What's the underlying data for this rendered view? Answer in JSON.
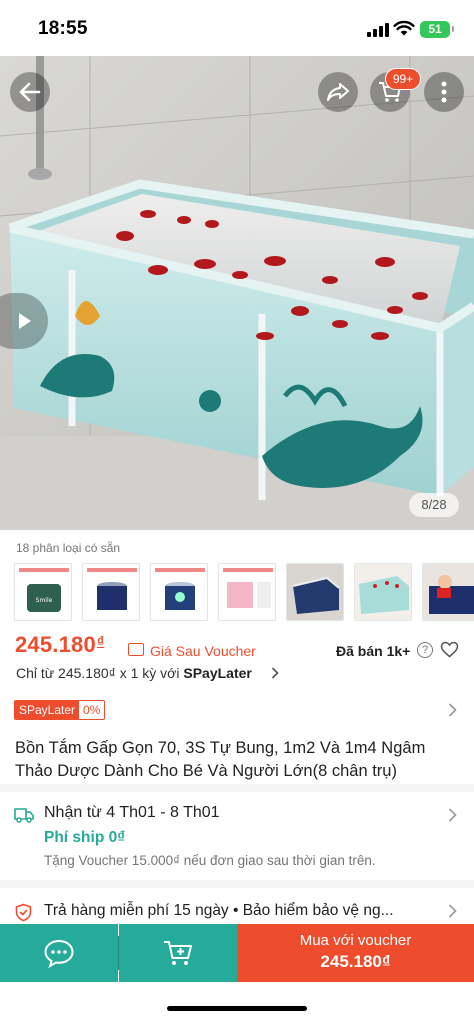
{
  "status_bar": {
    "time": "18:55",
    "battery": "51"
  },
  "hero": {
    "image_counter": "8/28",
    "cart_badge": "99+"
  },
  "variants": {
    "label": "18 phân loại có sẵn"
  },
  "price": {
    "value": "245.180",
    "currency": "₫",
    "note": "Giá Sau Voucher",
    "sold": "Đã bán 1k+",
    "help": "?"
  },
  "installment": {
    "prefix": "Chỉ từ 245.180₫ x 1 kỳ với ",
    "provider": "SPayLater"
  },
  "spaylater_badge": {
    "label": "SPayLater",
    "rate": "0%"
  },
  "product": {
    "title": "Bồn Tắm Gấp Gọn 70, 3S Tự Bung, 1m2 Và 1m4 Ngâm Thảo Dược Dành Cho Bé Và Người Lớn(8 chân trụ)"
  },
  "shipping": {
    "date": "Nhận từ 4 Th01 - 8 Th01",
    "fee": "Phí ship 0₫",
    "voucher": "Tặng Voucher 15.000₫ nếu đơn giao sau thời gian trên."
  },
  "returns": {
    "text": "Trả hàng miễn phí 15 ngày  •  Bảo hiểm bảo vệ ng..."
  },
  "bottom_bar": {
    "buy_label": "Mua với voucher",
    "buy_price": "245.180₫"
  },
  "colors": {
    "accent": "#ee4d2d",
    "teal": "#26aa99"
  },
  "icons": [
    "back-icon",
    "share-icon",
    "cart-icon",
    "more-icon",
    "play-icon",
    "voucher-icon",
    "help-icon",
    "heart-icon",
    "truck-icon",
    "shield-icon",
    "chevron-right-icon",
    "chat-icon",
    "add-to-cart-icon"
  ]
}
